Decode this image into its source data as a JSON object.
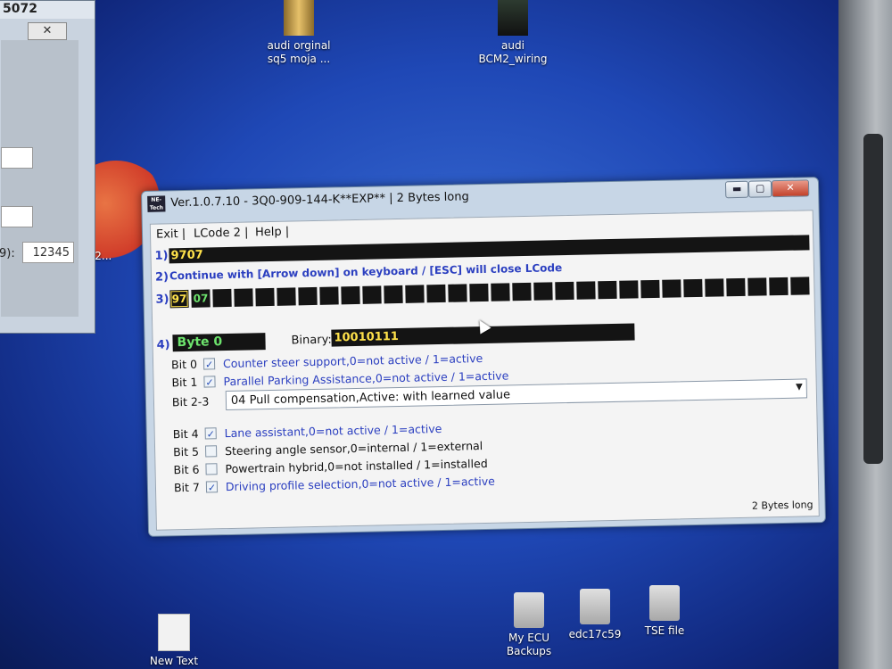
{
  "desktop": {
    "icons": [
      {
        "label_line1": "audi orginal",
        "label_line2": "sq5 moja ..."
      },
      {
        "label_line1": "audi",
        "label_line2": "BCM2_wiring"
      },
      {
        "label_line1": "My ECU",
        "label_line2": "Backups"
      },
      {
        "label_line1": "edc17c59",
        "label_line2": ""
      },
      {
        "label_line1": "TSE file",
        "label_line2": ""
      },
      {
        "label_line1": "New Text",
        "label_line2": ""
      }
    ],
    "partial_label": "22..."
  },
  "bg_window": {
    "number": "5072",
    "close_glyph": "✕",
    "field_label": "9):",
    "field_value": "12345"
  },
  "app": {
    "icon_text": "NE-Tech",
    "title": "Ver.1.0.7.10 -   3Q0-909-144-K**EXP** | 2 Bytes long",
    "menu": {
      "exit": "Exit |",
      "lcode2": "LCode 2 |",
      "help": "Help |"
    },
    "row_numbers": [
      "1)",
      "2)",
      "3)",
      "4)"
    ],
    "code_value": "9707",
    "instruction": "Continue with [Arrow down] on keyboard / [ESC] will close LCode",
    "cells": [
      "97",
      "07"
    ],
    "byte_label": "Byte 0",
    "binary_label": "Binary:",
    "binary_value": "10010111",
    "bits": [
      {
        "label": "Bit 0",
        "checked": true,
        "text": "Counter steer support,0=not active / 1=active"
      },
      {
        "label": "Bit 1",
        "checked": true,
        "text": "Parallel Parking Assistance,0=not active / 1=active"
      },
      {
        "label": "Bit 2-3",
        "dropdown_value": "04 Pull compensation,Active: with learned value"
      },
      {
        "label": "Bit 4",
        "checked": true,
        "text": "Lane assistant,0=not active / 1=active"
      },
      {
        "label": "Bit 5",
        "checked": false,
        "text": "Steering angle sensor,0=internal / 1=external"
      },
      {
        "label": "Bit 6",
        "checked": false,
        "text": "Powertrain hybrid,0=not installed / 1=installed"
      },
      {
        "label": "Bit 7",
        "checked": true,
        "text": "Driving profile selection,0=not active / 1=active"
      }
    ],
    "status": "2 Bytes long",
    "check_glyph": "✓",
    "dropdown_glyph": "▼",
    "win_buttons": {
      "minimize": "▬",
      "maximize": "▢",
      "close": "✕"
    }
  }
}
